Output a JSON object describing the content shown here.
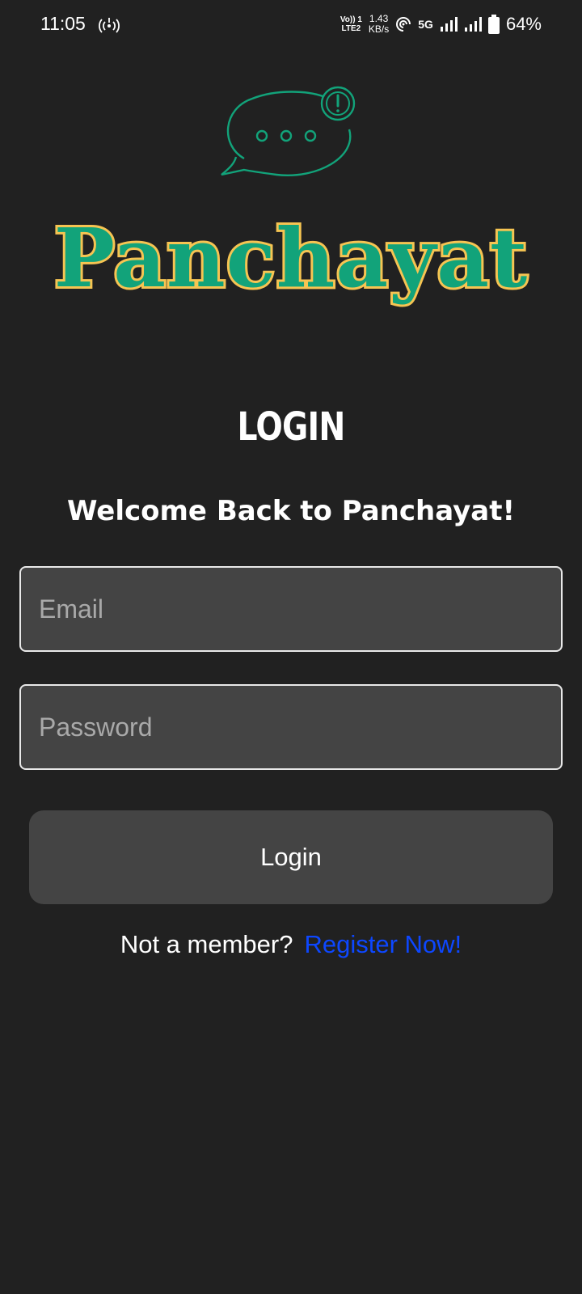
{
  "status_bar": {
    "time": "11:05",
    "volte_top": "Vo)) 1",
    "volte_bottom": "LTE2",
    "speed_value": "1.43",
    "speed_unit": "KB/s",
    "network_type": "5G",
    "battery_percent": "64%"
  },
  "brand": {
    "name": "Panchayat",
    "green": "#12a37a",
    "yellow": "#f6c452"
  },
  "login": {
    "heading": "LOGIN",
    "welcome": "Welcome Back to Panchayat!",
    "email_placeholder": "Email",
    "password_placeholder": "Password",
    "button_label": "Login",
    "not_member": "Not a member?",
    "register_link": "Register Now!"
  },
  "colors": {
    "background": "#212121",
    "input_bg": "#444444",
    "link": "#0d47ff"
  }
}
